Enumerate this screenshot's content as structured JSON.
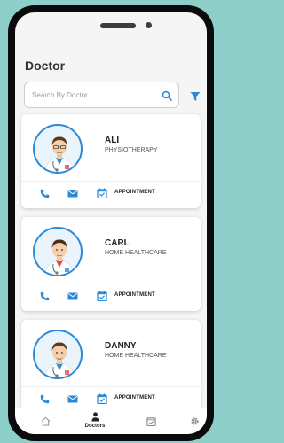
{
  "header": {
    "title": "Doctor"
  },
  "search": {
    "placeholder": "Search By Doctor"
  },
  "doctors": [
    {
      "name": "ALI",
      "specialty": "PHYSIOTHERAPY",
      "appointment_label": "APPOINTMENT"
    },
    {
      "name": "CARL",
      "specialty": "HOME HEALTHCARE",
      "appointment_label": "APPOINTMENT"
    },
    {
      "name": "DANNY",
      "specialty": "HOME HEALTHCARE",
      "appointment_label": "APPOINTMENT"
    }
  ],
  "bottom_nav": {
    "items": [
      {
        "label": "",
        "icon": "home-icon"
      },
      {
        "label": "Doctors",
        "icon": "person-icon"
      },
      {
        "label": "",
        "icon": "calendar-check-icon"
      },
      {
        "label": "",
        "icon": "gear-icon"
      }
    ]
  },
  "colors": {
    "accent": "#2b8ad8",
    "background": "#8ecfc9",
    "phone_frame": "#0b0b0b"
  }
}
